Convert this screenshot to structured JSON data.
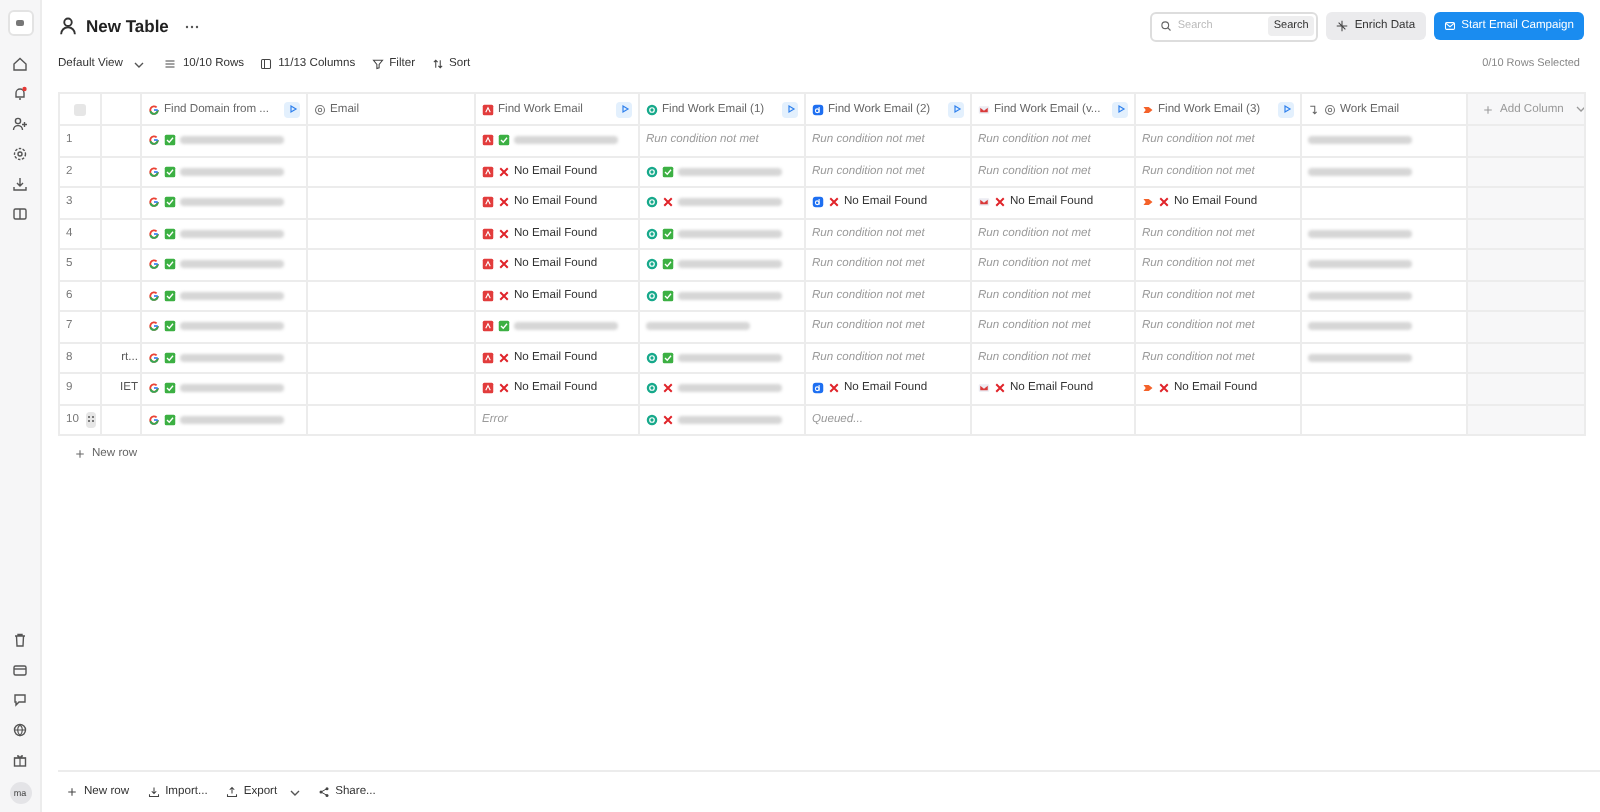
{
  "sidebar": {
    "avatar": "ma"
  },
  "header": {
    "title": "New Table"
  },
  "toolbar": {
    "view": "Default View",
    "rows": "10/10 Rows",
    "columns": "11/13 Columns",
    "filter": "Filter",
    "sort": "Sort",
    "selection": "0/10 Rows Selected"
  },
  "search": {
    "placeholder": "Search",
    "button": "Search"
  },
  "actions": [
    {
      "label": "Enrich Data",
      "kind": "secondary"
    },
    {
      "label": "Start Email Campaign",
      "kind": "primary"
    }
  ],
  "table": {
    "select_all_checked": false,
    "columns": [
      {
        "label": "Find Domain from ...",
        "icons": [
          {
            "kind": "google"
          }
        ],
        "run_button": true
      },
      {
        "label": "Email",
        "icons": [
          {
            "kind": "at"
          }
        ],
        "run_button": false
      },
      {
        "label": "Find Work Email",
        "icons": [
          {
            "kind": "red"
          }
        ],
        "run_button": true
      },
      {
        "label": "Find Work Email (1)",
        "icons": [
          {
            "kind": "teal"
          }
        ],
        "run_button": true
      },
      {
        "label": "Find Work Email (2)",
        "icons": [
          {
            "kind": "blue"
          }
        ],
        "run_button": true
      },
      {
        "label": "Find Work Email (v...",
        "icons": [
          {
            "kind": "mail"
          }
        ],
        "run_button": true
      },
      {
        "label": "Find Work Email (3)",
        "icons": [
          {
            "kind": "orange"
          }
        ],
        "run_button": true
      },
      {
        "label": "Work Email",
        "icons": [
          {
            "kind": "merge"
          },
          {
            "kind": "at"
          }
        ],
        "run_button": false
      }
    ],
    "add_column": "Add Column",
    "rows": [
      {
        "number": "1",
        "handle": false,
        "cells": [
          {
            "kind": "found_blur"
          },
          {
            "kind": "empty"
          },
          {
            "kind": "found_blur"
          },
          {
            "kind": "run",
            "text": "Run condition not met"
          },
          {
            "kind": "run",
            "text": "Run condition not met"
          },
          {
            "kind": "run",
            "text": "Run condition not met"
          },
          {
            "kind": "run",
            "text": "Run condition not met"
          },
          {
            "kind": "blur"
          }
        ]
      },
      {
        "number": "2",
        "handle": false,
        "cells": [
          {
            "kind": "found_blur"
          },
          {
            "kind": "empty"
          },
          {
            "kind": "not_found",
            "text": "No Email Found"
          },
          {
            "kind": "found_blur"
          },
          {
            "kind": "run",
            "text": "Run condition not met"
          },
          {
            "kind": "run",
            "text": "Run condition not met"
          },
          {
            "kind": "run",
            "text": "Run condition not met"
          },
          {
            "kind": "blur"
          }
        ]
      },
      {
        "number": "3",
        "handle": false,
        "cells": [
          {
            "kind": "found_blur"
          },
          {
            "kind": "empty"
          },
          {
            "kind": "not_found",
            "text": "No Email Found"
          },
          {
            "kind": "not_found_blur"
          },
          {
            "kind": "not_found",
            "text": "No Email Found"
          },
          {
            "kind": "not_found",
            "text": "No Email Found"
          },
          {
            "kind": "not_found",
            "text": "No Email Found"
          },
          {
            "kind": "empty"
          }
        ]
      },
      {
        "number": "4",
        "handle": false,
        "cells": [
          {
            "kind": "found_blur"
          },
          {
            "kind": "empty"
          },
          {
            "kind": "not_found",
            "text": "No Email Found"
          },
          {
            "kind": "found_blur"
          },
          {
            "kind": "run",
            "text": "Run condition not met"
          },
          {
            "kind": "run",
            "text": "Run condition not met"
          },
          {
            "kind": "run",
            "text": "Run condition not met"
          },
          {
            "kind": "blur"
          }
        ]
      },
      {
        "number": "5",
        "handle": false,
        "cells": [
          {
            "kind": "found_blur"
          },
          {
            "kind": "empty"
          },
          {
            "kind": "not_found",
            "text": "No Email Found"
          },
          {
            "kind": "found_blur"
          },
          {
            "kind": "run",
            "text": "Run condition not met"
          },
          {
            "kind": "run",
            "text": "Run condition not met"
          },
          {
            "kind": "run",
            "text": "Run condition not met"
          },
          {
            "kind": "blur"
          }
        ]
      },
      {
        "number": "6",
        "handle": false,
        "cells": [
          {
            "kind": "found_blur"
          },
          {
            "kind": "empty"
          },
          {
            "kind": "not_found",
            "text": "No Email Found"
          },
          {
            "kind": "found_blur"
          },
          {
            "kind": "run",
            "text": "Run condition not met"
          },
          {
            "kind": "run",
            "text": "Run condition not met"
          },
          {
            "kind": "run",
            "text": "Run condition not met"
          },
          {
            "kind": "blur"
          }
        ]
      },
      {
        "number": "7",
        "handle": false,
        "cells": [
          {
            "kind": "found_blur"
          },
          {
            "kind": "empty"
          },
          {
            "kind": "found_blur"
          },
          {
            "kind": "blur"
          },
          {
            "kind": "run",
            "text": "Run condition not met"
          },
          {
            "kind": "run",
            "text": "Run condition not met"
          },
          {
            "kind": "run",
            "text": "Run condition not met"
          },
          {
            "kind": "blur"
          }
        ]
      },
      {
        "number": "8",
        "label": "rt...",
        "handle": false,
        "cells": [
          {
            "kind": "found_blur"
          },
          {
            "kind": "empty"
          },
          {
            "kind": "not_found",
            "text": "No Email Found"
          },
          {
            "kind": "found_blur"
          },
          {
            "kind": "run",
            "text": "Run condition not met"
          },
          {
            "kind": "run",
            "text": "Run condition not met"
          },
          {
            "kind": "run",
            "text": "Run condition not met"
          },
          {
            "kind": "blur"
          }
        ]
      },
      {
        "number": "9",
        "label": "IET",
        "handle": false,
        "cells": [
          {
            "kind": "found_blur"
          },
          {
            "kind": "empty"
          },
          {
            "kind": "not_found",
            "text": "No Email Found"
          },
          {
            "kind": "not_found_blur"
          },
          {
            "kind": "not_found",
            "text": "No Email Found"
          },
          {
            "kind": "not_found",
            "text": "No Email Found"
          },
          {
            "kind": "not_found",
            "text": "No Email Found"
          },
          {
            "kind": "empty"
          }
        ]
      },
      {
        "number": "10",
        "handle": true,
        "cells": [
          {
            "kind": "found_blur"
          },
          {
            "kind": "empty"
          },
          {
            "kind": "note",
            "text": "Error"
          },
          {
            "kind": "not_found_blur"
          },
          {
            "kind": "note",
            "text": "Queued..."
          },
          {
            "kind": "empty"
          },
          {
            "kind": "empty"
          },
          {
            "kind": "empty"
          }
        ]
      }
    ],
    "new_row": "New row"
  },
  "footer": [
    {
      "label": "New row",
      "kind": "plus",
      "dropdown": false
    },
    {
      "label": "Import...",
      "kind": "download",
      "dropdown": false
    },
    {
      "label": "Export",
      "kind": "upload",
      "dropdown": true
    },
    {
      "label": "Share...",
      "kind": "share",
      "dropdown": false
    }
  ]
}
